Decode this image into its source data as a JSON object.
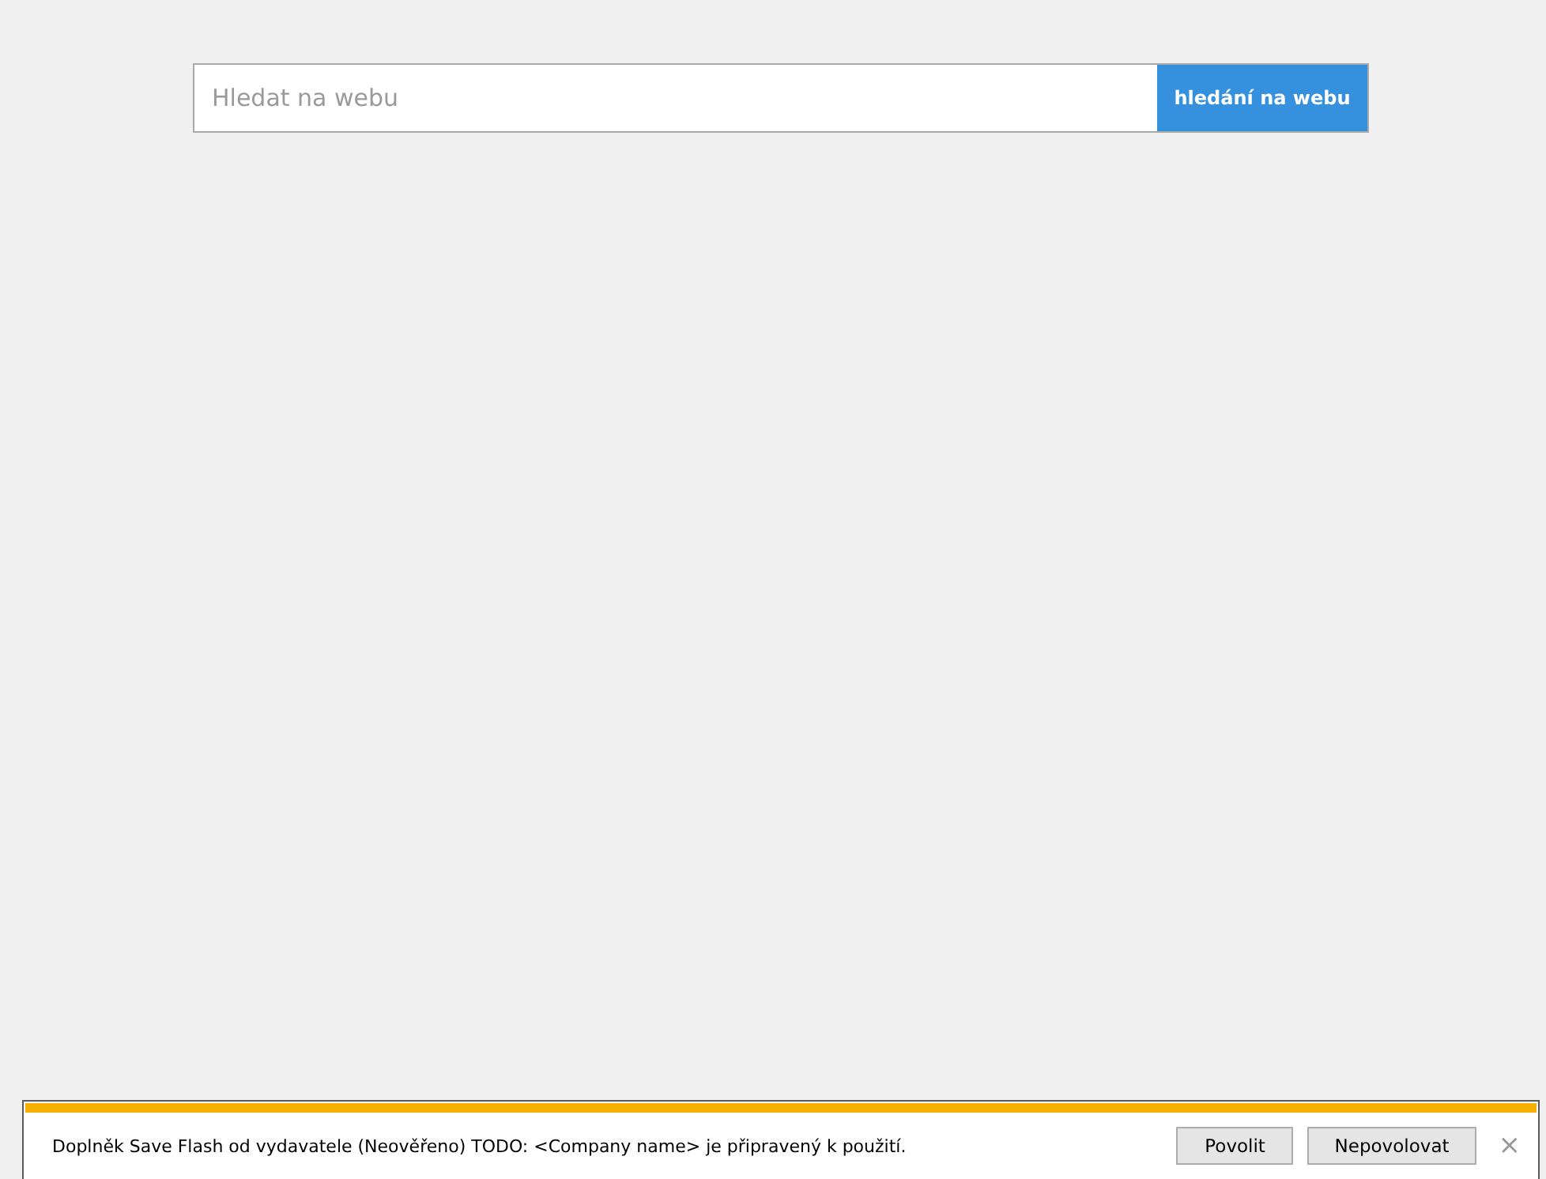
{
  "search": {
    "placeholder": "Hledat na webu",
    "button": "hledání na webu"
  },
  "notification": {
    "message": "Doplněk Save Flash od vydavatele (Neověřeno) TODO: <Company name> je připravený k použití.",
    "buttons": [
      "Povolit",
      "Nepovolovat"
    ],
    "close": "×"
  }
}
